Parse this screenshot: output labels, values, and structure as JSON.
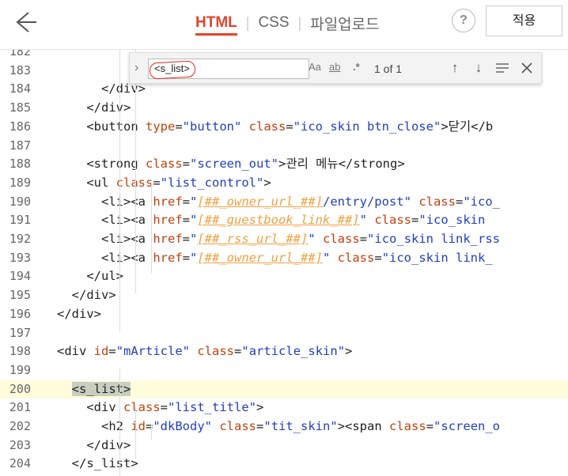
{
  "header": {
    "tabs": [
      {
        "label": "HTML",
        "active": true
      },
      {
        "label": "CSS",
        "active": false
      },
      {
        "label": "파일업로드",
        "active": false
      }
    ],
    "help_label": "?",
    "apply_label": "적용"
  },
  "find": {
    "value": "<s_list>",
    "option_case": "Aa",
    "option_word": "ab",
    "option_regex": ".*",
    "count": "1 of 1"
  },
  "editor": {
    "highlight_line": "200",
    "lines": [
      {
        "n": "182",
        "tokens": []
      },
      {
        "n": "183",
        "tokens": []
      },
      {
        "n": "184",
        "tokens": [
          {
            "c": "t",
            "v": "      </div>"
          }
        ]
      },
      {
        "n": "185",
        "tokens": [
          {
            "c": "t",
            "v": "    </div>"
          }
        ]
      },
      {
        "n": "186",
        "tokens": [
          {
            "c": "t",
            "v": "    <button "
          },
          {
            "c": "a",
            "v": "type"
          },
          {
            "c": "t",
            "v": "="
          },
          {
            "c": "s",
            "v": "\"button\""
          },
          {
            "c": "t",
            "v": " "
          },
          {
            "c": "a",
            "v": "class"
          },
          {
            "c": "t",
            "v": "="
          },
          {
            "c": "s",
            "v": "\"ico_skin btn_close\""
          },
          {
            "c": "t",
            "v": ">닫기</b"
          }
        ]
      },
      {
        "n": "187",
        "tokens": []
      },
      {
        "n": "188",
        "tokens": [
          {
            "c": "t",
            "v": "    <strong "
          },
          {
            "c": "a",
            "v": "class"
          },
          {
            "c": "t",
            "v": "="
          },
          {
            "c": "s",
            "v": "\"screen_out\""
          },
          {
            "c": "t",
            "v": ">관리 메뉴</strong>"
          }
        ]
      },
      {
        "n": "189",
        "tokens": [
          {
            "c": "t",
            "v": "    <ul "
          },
          {
            "c": "a",
            "v": "class"
          },
          {
            "c": "t",
            "v": "="
          },
          {
            "c": "s",
            "v": "\"list_control\""
          },
          {
            "c": "t",
            "v": ">"
          }
        ]
      },
      {
        "n": "190",
        "tokens": [
          {
            "c": "t",
            "v": "      <li><a "
          },
          {
            "c": "a",
            "v": "href"
          },
          {
            "c": "t",
            "v": "="
          },
          {
            "c": "s",
            "v": "\""
          },
          {
            "c": "v",
            "v": "[##_owner_url_##]"
          },
          {
            "c": "s",
            "v": "/entry/post\""
          },
          {
            "c": "t",
            "v": " "
          },
          {
            "c": "a",
            "v": "class"
          },
          {
            "c": "t",
            "v": "="
          },
          {
            "c": "s",
            "v": "\"ico_"
          }
        ]
      },
      {
        "n": "191",
        "tokens": [
          {
            "c": "t",
            "v": "      <li><a "
          },
          {
            "c": "a",
            "v": "href"
          },
          {
            "c": "t",
            "v": "="
          },
          {
            "c": "s",
            "v": "\""
          },
          {
            "c": "v",
            "v": "[##_guestbook_link_##]"
          },
          {
            "c": "s",
            "v": "\""
          },
          {
            "c": "t",
            "v": " "
          },
          {
            "c": "a",
            "v": "class"
          },
          {
            "c": "t",
            "v": "="
          },
          {
            "c": "s",
            "v": "\"ico_skin "
          }
        ]
      },
      {
        "n": "192",
        "tokens": [
          {
            "c": "t",
            "v": "      <li><a "
          },
          {
            "c": "a",
            "v": "href"
          },
          {
            "c": "t",
            "v": "="
          },
          {
            "c": "s",
            "v": "\""
          },
          {
            "c": "v",
            "v": "[##_rss_url_##]"
          },
          {
            "c": "s",
            "v": "\""
          },
          {
            "c": "t",
            "v": " "
          },
          {
            "c": "a",
            "v": "class"
          },
          {
            "c": "t",
            "v": "="
          },
          {
            "c": "s",
            "v": "\"ico_skin link_rss"
          }
        ]
      },
      {
        "n": "193",
        "tokens": [
          {
            "c": "t",
            "v": "      <li><a "
          },
          {
            "c": "a",
            "v": "href"
          },
          {
            "c": "t",
            "v": "="
          },
          {
            "c": "s",
            "v": "\""
          },
          {
            "c": "v",
            "v": "[##_owner_url_##]"
          },
          {
            "c": "s",
            "v": "\""
          },
          {
            "c": "t",
            "v": " "
          },
          {
            "c": "a",
            "v": "class"
          },
          {
            "c": "t",
            "v": "="
          },
          {
            "c": "s",
            "v": "\"ico_skin link_"
          }
        ]
      },
      {
        "n": "194",
        "tokens": [
          {
            "c": "t",
            "v": "    </ul>"
          }
        ]
      },
      {
        "n": "195",
        "tokens": [
          {
            "c": "t",
            "v": "  </div>"
          }
        ]
      },
      {
        "n": "196",
        "tokens": [
          {
            "c": "t",
            "v": "</div>"
          }
        ]
      },
      {
        "n": "197",
        "tokens": []
      },
      {
        "n": "198",
        "tokens": [
          {
            "c": "t",
            "v": "<div "
          },
          {
            "c": "a",
            "v": "id"
          },
          {
            "c": "t",
            "v": "="
          },
          {
            "c": "s",
            "v": "\"mArticle\""
          },
          {
            "c": "t",
            "v": " "
          },
          {
            "c": "a",
            "v": "class"
          },
          {
            "c": "t",
            "v": "="
          },
          {
            "c": "s",
            "v": "\"article_skin\""
          },
          {
            "c": "t",
            "v": ">"
          }
        ]
      },
      {
        "n": "199",
        "tokens": []
      },
      {
        "n": "200",
        "tokens": [
          {
            "c": "t",
            "v": "  "
          },
          {
            "c": "sel",
            "v": "<s_list>"
          }
        ]
      },
      {
        "n": "201",
        "tokens": [
          {
            "c": "t",
            "v": "    <div "
          },
          {
            "c": "a",
            "v": "class"
          },
          {
            "c": "t",
            "v": "="
          },
          {
            "c": "s",
            "v": "\"list_title\""
          },
          {
            "c": "t",
            "v": ">"
          }
        ]
      },
      {
        "n": "202",
        "tokens": [
          {
            "c": "t",
            "v": "      <h2 "
          },
          {
            "c": "a",
            "v": "id"
          },
          {
            "c": "t",
            "v": "="
          },
          {
            "c": "s",
            "v": "\"dkBody\""
          },
          {
            "c": "t",
            "v": " "
          },
          {
            "c": "a",
            "v": "class"
          },
          {
            "c": "t",
            "v": "="
          },
          {
            "c": "s",
            "v": "\"tit_skin\""
          },
          {
            "c": "t",
            "v": "><span "
          },
          {
            "c": "a",
            "v": "class"
          },
          {
            "c": "t",
            "v": "="
          },
          {
            "c": "s",
            "v": "\"screen_o"
          }
        ]
      },
      {
        "n": "203",
        "tokens": [
          {
            "c": "t",
            "v": "    </div>"
          }
        ]
      },
      {
        "n": "204",
        "tokens": [
          {
            "c": "t",
            "v": "  </s_list>"
          }
        ]
      }
    ]
  }
}
